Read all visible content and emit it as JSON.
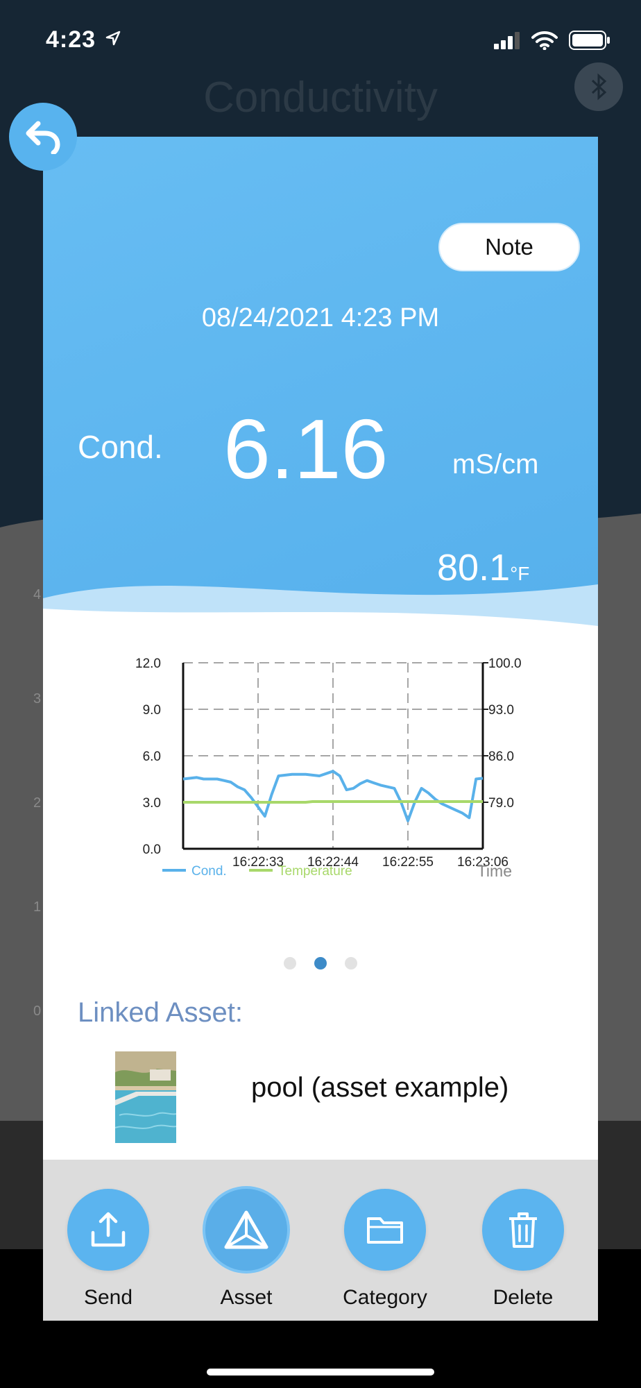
{
  "status_bar": {
    "time": "4:23"
  },
  "background": {
    "title": "Conductivity",
    "left_ticks": [
      "4",
      "3",
      "2",
      "1",
      "0"
    ]
  },
  "note_button": "Note",
  "reading": {
    "datetime": "08/24/2021 4:23 PM",
    "label": "Cond.",
    "value": "6.16",
    "unit": "mS/cm",
    "temperature_value": "80.1",
    "temperature_unit": "°F"
  },
  "chart_data": {
    "type": "line",
    "x": [
      "16:22:22",
      "16:22:23",
      "16:22:24",
      "16:22:25",
      "16:22:26",
      "16:22:27",
      "16:22:28",
      "16:22:29",
      "16:22:30",
      "16:22:31",
      "16:22:32",
      "16:22:33",
      "16:22:34",
      "16:22:35",
      "16:22:36",
      "16:22:37",
      "16:22:38",
      "16:22:39",
      "16:22:40",
      "16:22:41",
      "16:22:42",
      "16:22:43",
      "16:22:44",
      "16:22:45",
      "16:22:46",
      "16:22:47",
      "16:22:48",
      "16:22:49",
      "16:22:50",
      "16:22:51",
      "16:22:52",
      "16:22:53",
      "16:22:54",
      "16:22:55",
      "16:22:56",
      "16:22:57",
      "16:22:58",
      "16:22:59",
      "16:23:00",
      "16:23:01",
      "16:23:02",
      "16:23:03",
      "16:23:04",
      "16:23:05",
      "16:23:06"
    ],
    "x_ticks": [
      "16:22:33",
      "16:22:44",
      "16:22:55",
      "16:23:06"
    ],
    "xlabel": "Time",
    "series": [
      {
        "name": "Cond.",
        "axis": "left",
        "color": "#59b1ea",
        "values": [
          4.5,
          4.55,
          4.6,
          4.5,
          4.5,
          4.5,
          4.4,
          4.3,
          4.0,
          3.8,
          3.3,
          2.7,
          2.1,
          3.5,
          4.7,
          4.75,
          4.8,
          4.8,
          4.8,
          4.75,
          4.7,
          4.85,
          5.0,
          4.7,
          3.8,
          3.9,
          4.2,
          4.4,
          4.25,
          4.1,
          4.0,
          3.9,
          3.0,
          1.8,
          3.0,
          3.9,
          3.6,
          3.2,
          2.9,
          2.7,
          2.5,
          2.3,
          2.0,
          4.5,
          4.55
        ]
      },
      {
        "name": "Temperature",
        "axis": "right",
        "color": "#a8d86a",
        "values": [
          79.0,
          79.0,
          79.0,
          79.0,
          79.0,
          79.0,
          79.0,
          79.0,
          79.0,
          79.0,
          79.0,
          79.0,
          79.0,
          79.0,
          79.0,
          79.0,
          79.0,
          79.0,
          79.0,
          79.1,
          79.1,
          79.1,
          79.1,
          79.1,
          79.1,
          79.1,
          79.1,
          79.1,
          79.1,
          79.1,
          79.1,
          79.1,
          79.1,
          79.1,
          79.1,
          79.1,
          79.1,
          79.1,
          79.1,
          79.1,
          79.1,
          79.1,
          79.1,
          79.1,
          79.1
        ]
      }
    ],
    "left_axis": {
      "ticks": [
        "0.0",
        "3.0",
        "6.0",
        "9.0",
        "12.0"
      ],
      "ylim": [
        0,
        12
      ]
    },
    "right_axis": {
      "ticks": [
        "79.0",
        "86.0",
        "93.0",
        "100.0"
      ],
      "ylim": [
        72,
        100
      ]
    },
    "grid": true,
    "legend": "bottom-left"
  },
  "pager": {
    "count": 3,
    "active": 1
  },
  "linked_asset": {
    "label": "Linked Asset:",
    "name": "pool (asset example)"
  },
  "toolbar": {
    "send": "Send",
    "asset": "Asset",
    "category": "Category",
    "delete": "Delete"
  },
  "icons": {
    "back": "undo-arrow-icon",
    "send": "share-upload-icon",
    "asset": "triangle-asset-icon",
    "category": "folder-icon",
    "delete": "trash-icon",
    "bluetooth": "bluetooth-icon"
  },
  "colors": {
    "primary": "#5bb4ef",
    "linked_label": "#6d8fc1",
    "pager_active": "#3d8bc8"
  }
}
